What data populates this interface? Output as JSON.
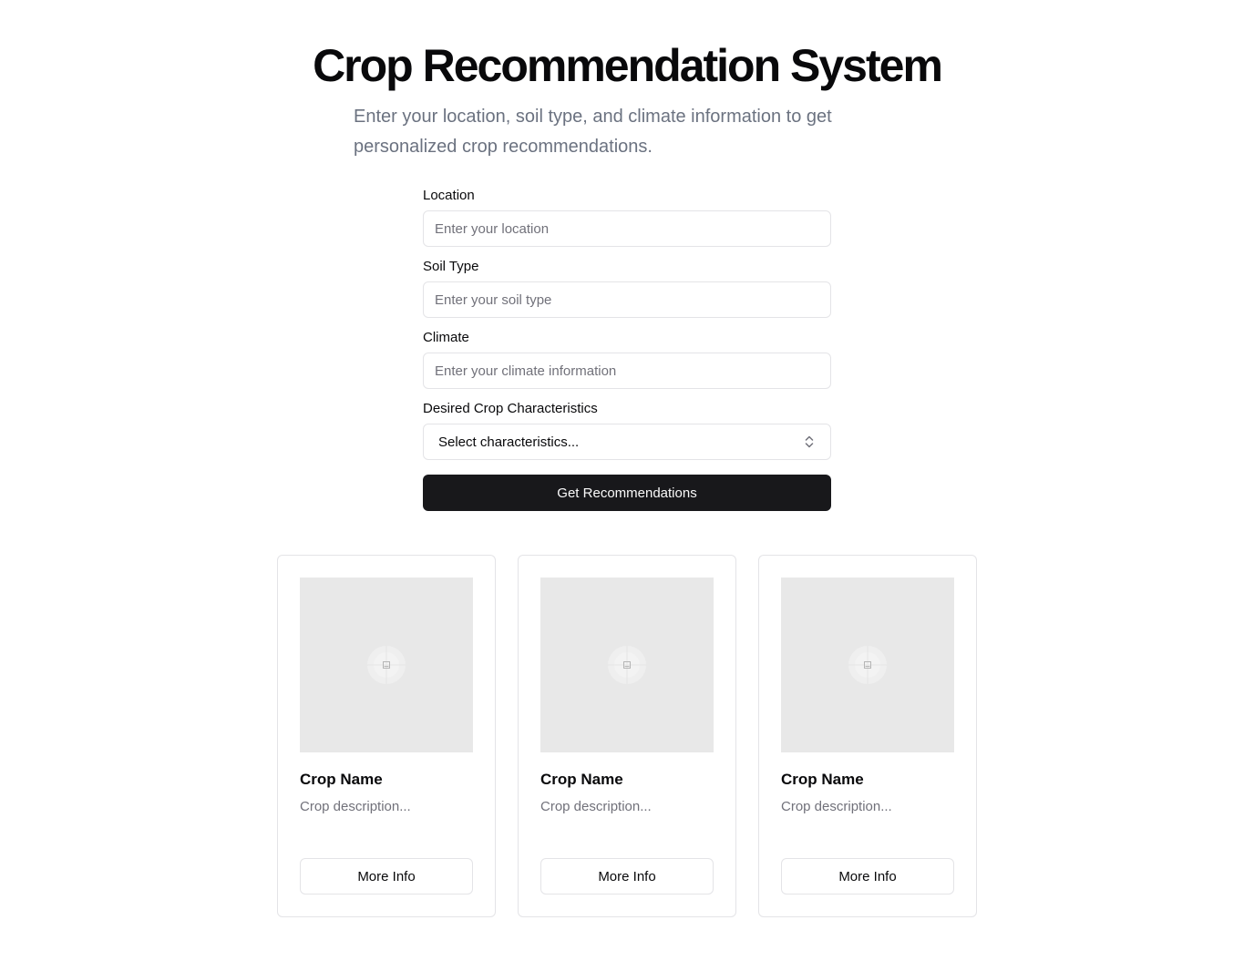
{
  "header": {
    "title": "Crop Recommendation System",
    "subtitle": "Enter your location, soil type, and climate information to get personalized crop recommendations."
  },
  "form": {
    "location": {
      "label": "Location",
      "placeholder": "Enter your location",
      "value": ""
    },
    "soil_type": {
      "label": "Soil Type",
      "placeholder": "Enter your soil type",
      "value": ""
    },
    "climate": {
      "label": "Climate",
      "placeholder": "Enter your climate information",
      "value": ""
    },
    "characteristics": {
      "label": "Desired Crop Characteristics",
      "selected": "Select characteristics..."
    },
    "submit_label": "Get Recommendations"
  },
  "cards": [
    {
      "title": "Crop Name",
      "description": "Crop description...",
      "button_label": "More Info",
      "image_icon": "image-placeholder-icon"
    },
    {
      "title": "Crop Name",
      "description": "Crop description...",
      "button_label": "More Info",
      "image_icon": "image-placeholder-icon"
    },
    {
      "title": "Crop Name",
      "description": "Crop description...",
      "button_label": "More Info",
      "image_icon": "image-placeholder-icon"
    }
  ],
  "colors": {
    "primary": "#18181b",
    "muted_text": "#71717a",
    "border": "#e4e4e7",
    "image_placeholder": "#e8e8e8"
  }
}
